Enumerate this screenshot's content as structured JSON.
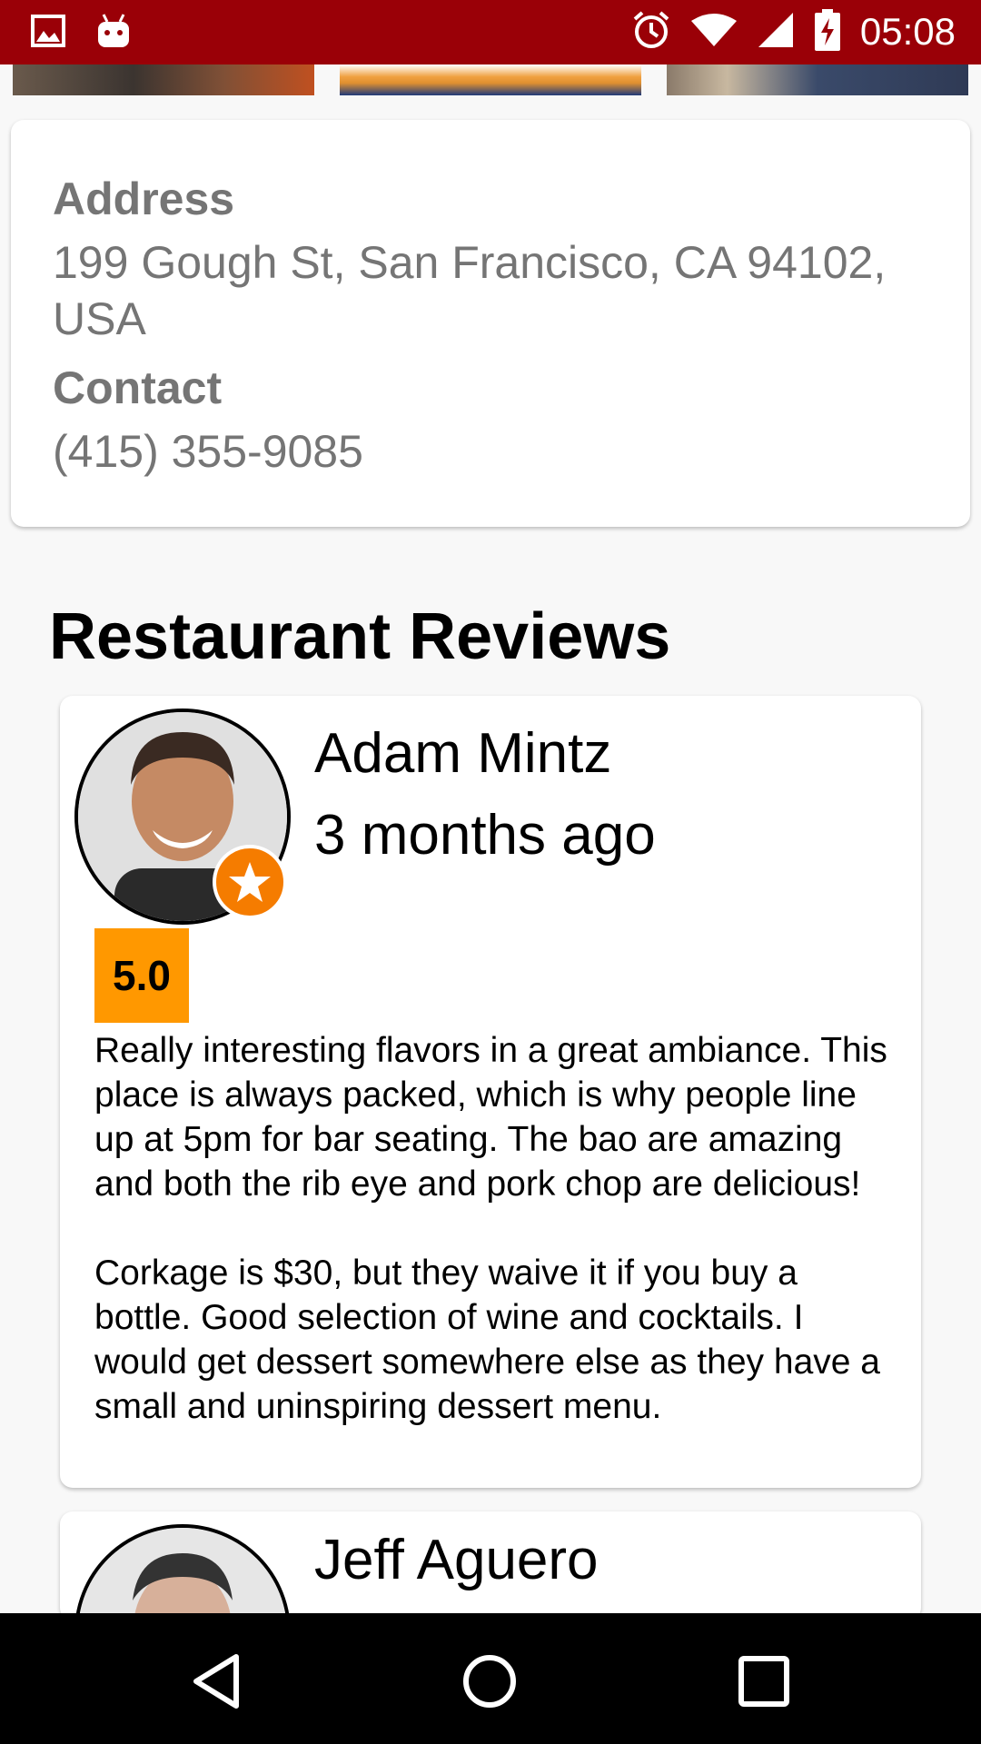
{
  "status_bar": {
    "time": "05:08",
    "icons": [
      "gallery-icon",
      "android-icon",
      "alarm-icon",
      "wifi-icon",
      "signal-icon",
      "battery-charging-icon"
    ]
  },
  "info": {
    "address_label": "Address",
    "address_value": "199 Gough St, San Francisco, CA 94102, USA",
    "contact_label": "Contact",
    "contact_value": "(415) 355-9085"
  },
  "reviews_title": "Restaurant Reviews",
  "reviews": [
    {
      "name": "Adam Mintz",
      "time": "3 months ago",
      "rating": "5.0",
      "text_p1": "Really interesting flavors in a great ambiance. This place is always packed, which is why people line up at 5pm for bar seating. The bao are amazing and both the rib eye and pork chop are delicious!",
      "text_p2": "Corkage is $30, but they waive it if you buy a bottle. Good selection of wine and cocktails. I would get dessert somewhere else as they have a small and uninspiring dessert menu."
    },
    {
      "name": "Jeff Aguero"
    }
  ],
  "nav": {
    "icons": [
      "back-icon",
      "home-icon",
      "recents-icon"
    ]
  },
  "colors": {
    "status_bar": "#9a0007",
    "rating_badge": "#ff9800",
    "label_gray": "#757575"
  }
}
